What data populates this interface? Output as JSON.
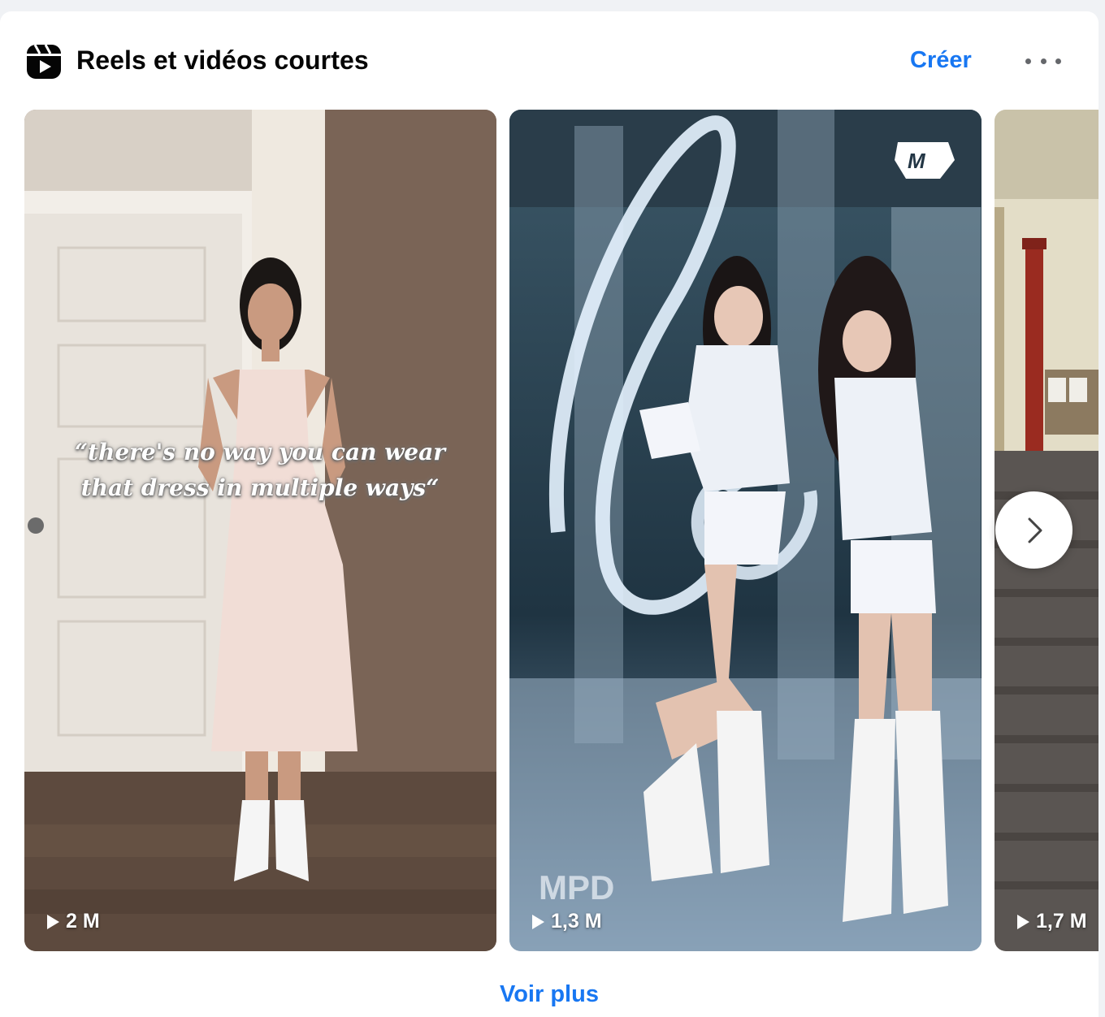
{
  "header": {
    "title": "Reels et vidéos courtes",
    "create_label": "Créer"
  },
  "reels": [
    {
      "caption": "“there's no way you can wear that dress in multiple ways“",
      "views": "2 M"
    },
    {
      "views": "1,3 M"
    },
    {
      "views": "1,7 M"
    }
  ],
  "footer": {
    "see_more_label": "Voir plus"
  },
  "colors": {
    "accent": "#1877f2",
    "text": "#050505",
    "icon_gray": "#65676b"
  },
  "icons": [
    "reels-icon",
    "more-options-icon",
    "play-icon",
    "chevron-right-icon"
  ]
}
